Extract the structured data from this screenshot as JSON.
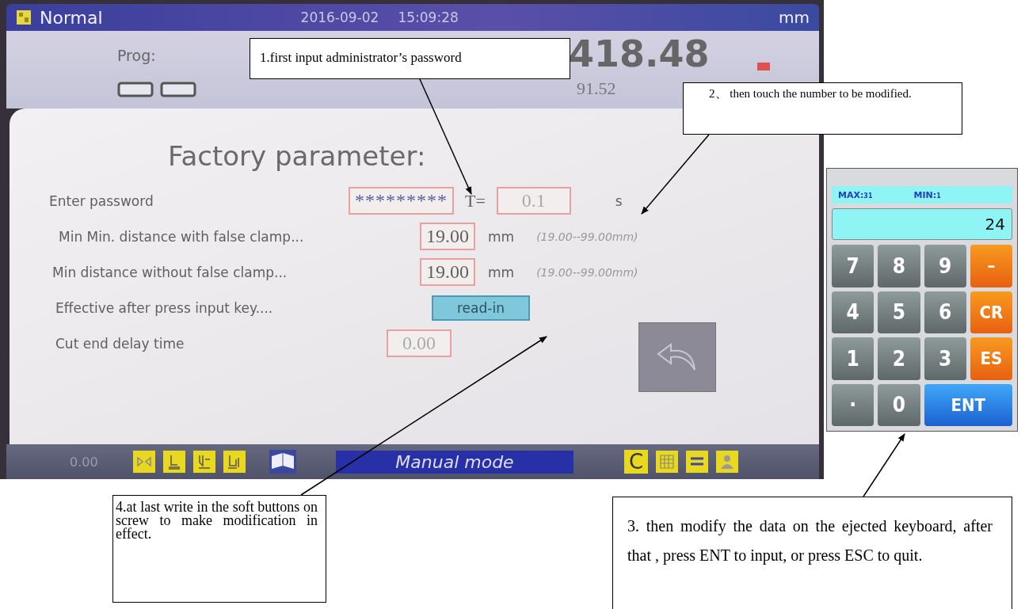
{
  "screen": {
    "mode": "Normal",
    "date": "2016-09-02",
    "time": "15:09:28",
    "unit": "mm",
    "prog_label": "Prog:",
    "main_value": "418.48",
    "secondary_value": "91.52",
    "title": "Factory parameter:",
    "rows": [
      {
        "kind": "password",
        "label": "Enter password",
        "value": "*********",
        "extra_label": "T=",
        "extra_value": "0.1",
        "unit": "s"
      },
      {
        "kind": "number",
        "label": "Min Min. distance with false clamp...",
        "value": "19.00",
        "unit": "mm",
        "range": "(19.00--99.00mm)"
      },
      {
        "kind": "number",
        "label": "Min distance without false clamp...",
        "value": "19.00",
        "unit": "mm",
        "range": "(19.00--99.00mm)"
      },
      {
        "kind": "button",
        "label": "Effective after press input key....",
        "button": "read-in"
      },
      {
        "kind": "delay",
        "label": "Cut end delay time",
        "value": "0.00"
      }
    ],
    "bottom_bar": {
      "value": "0.00",
      "status": "Manual mode",
      "letter_key": "C"
    }
  },
  "keypad": {
    "max_label": "MAX:",
    "max": "31",
    "min_label": "MIN:",
    "min": "1",
    "display": "24",
    "keys": [
      {
        "label": "7",
        "kind": "digit"
      },
      {
        "label": "8",
        "kind": "digit"
      },
      {
        "label": "9",
        "kind": "digit"
      },
      {
        "label": "–",
        "kind": "function"
      },
      {
        "label": "4",
        "kind": "digit"
      },
      {
        "label": "5",
        "kind": "digit"
      },
      {
        "label": "6",
        "kind": "digit"
      },
      {
        "label": "CR",
        "kind": "function"
      },
      {
        "label": "1",
        "kind": "digit"
      },
      {
        "label": "2",
        "kind": "digit"
      },
      {
        "label": "3",
        "kind": "digit"
      },
      {
        "label": "ES",
        "kind": "function"
      },
      {
        "label": "·",
        "kind": "digit"
      },
      {
        "label": "0",
        "kind": "digit"
      },
      {
        "label": "ENT",
        "kind": "enter"
      }
    ]
  },
  "callouts": [
    {
      "text": "1.first input administrator’s password"
    },
    {
      "text": "2、 then touch the number to be modified."
    },
    {
      "text": "3. then modify the data on the ejected keyboard, after that , press ENT to input, or press ESC to quit."
    },
    {
      "text": "4.at last write in the soft buttons on screw to make modification in effect."
    }
  ]
}
